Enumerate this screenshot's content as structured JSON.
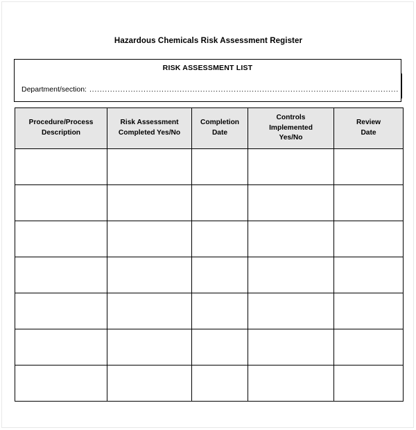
{
  "document": {
    "title": "Hazardous Chemicals Risk Assessment Register",
    "section_title": "RISK ASSESSMENT LIST",
    "department_label": "Department/section:",
    "department_value": "",
    "department_fill": "................................................................................................................................................................................................................................"
  },
  "table": {
    "columns": [
      {
        "id": "procedure-process-description",
        "lines": [
          "Procedure/Process",
          "Description"
        ]
      },
      {
        "id": "risk-assessment-completed",
        "lines": [
          "Risk Assessment",
          "Completed Yes/No"
        ]
      },
      {
        "id": "completion-date",
        "lines": [
          "Completion",
          "Date"
        ]
      },
      {
        "id": "controls-implemented",
        "lines": [
          "Controls",
          "Implemented",
          "Yes/No"
        ]
      },
      {
        "id": "review-date",
        "lines": [
          "Review",
          "Date"
        ]
      }
    ],
    "row_count": 7,
    "rows": [
      [
        "",
        "",
        "",
        "",
        ""
      ],
      [
        "",
        "",
        "",
        "",
        ""
      ],
      [
        "",
        "",
        "",
        "",
        ""
      ],
      [
        "",
        "",
        "",
        "",
        ""
      ],
      [
        "",
        "",
        "",
        "",
        ""
      ],
      [
        "",
        "",
        "",
        "",
        ""
      ],
      [
        "",
        "",
        "",
        "",
        ""
      ]
    ]
  },
  "colors": {
    "header_fill": "#e6e6e6",
    "border": "#000000",
    "page_border": "#e8e8e8",
    "text": "#000000",
    "background": "#ffffff"
  }
}
